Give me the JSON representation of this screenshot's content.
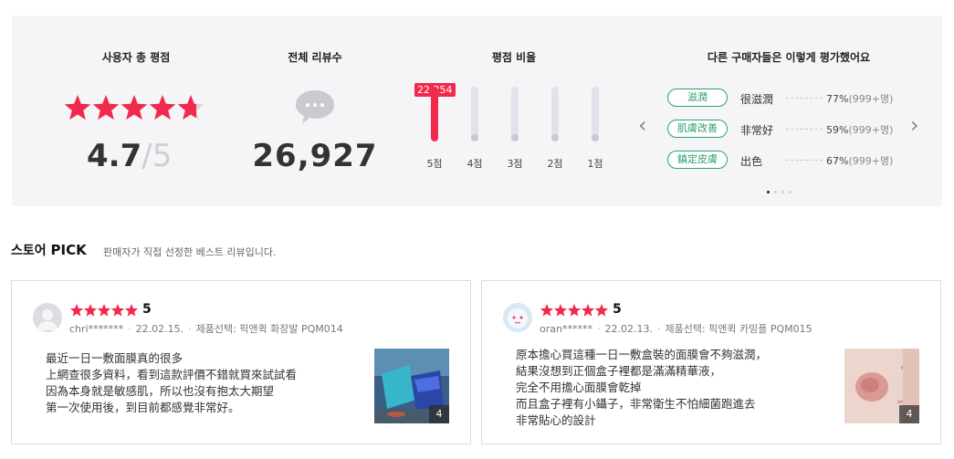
{
  "summary": {
    "rating_title": "사용자 총 평점",
    "rating_value": "4.7",
    "rating_sep": "/",
    "rating_max": "5",
    "rating_stars": 4.7,
    "reviews_title": "전체 리뷰수",
    "reviews_total": "26,927",
    "ratio_title": "평점 비율",
    "ratio_badge": "22,254",
    "ratio_bars": [
      {
        "label": "5점",
        "fraction": 1.0
      },
      {
        "label": "4점",
        "fraction": 0.0
      },
      {
        "label": "3점",
        "fraction": 0.0
      },
      {
        "label": "2점",
        "fraction": 0.0
      },
      {
        "label": "1점",
        "fraction": 0.0
      }
    ],
    "opinion_title": "다른 구매자들은 이렇게 평가했어요",
    "opinions": [
      {
        "tag": "滋潤",
        "word": "很滋潤",
        "pct": "77%",
        "count": "(999+명)"
      },
      {
        "tag": "肌膚改善",
        "word": "非常好",
        "pct": "59%",
        "count": "(999+명)"
      },
      {
        "tag": "鎮定皮膚",
        "word": "出色",
        "pct": "67%",
        "count": "(999+명)"
      }
    ],
    "prev_icon": "chevron-left-icon",
    "next_icon": "chevron-right-icon"
  },
  "pick": {
    "title_prefix": "스토어",
    "title_em": "PICK",
    "subtitle": "판매자가 직접 선정한 베스트 리뷰입니다."
  },
  "reviews": [
    {
      "score": "5",
      "user": "chri*******",
      "date": "22.02.15.",
      "option": "제품선택: 픽앤퀵 화장발 PQM014",
      "lines": [
        "最近一日一敷面膜真的很多",
        "上網查很多資料，看到這款評價不錯就買來試試看",
        "因為本身就是敏感肌，所以也沒有抱太大期望",
        "第一次使用後，到目前都感覺非常好。"
      ],
      "photo_count": "4"
    },
    {
      "score": "5",
      "user": "oran******",
      "date": "22.02.13.",
      "option": "제품선택: 픽앤퀵 카밍플 PQM015",
      "lines": [
        "原本擔心買這種一日一敷盒裝的面膜會不夠滋潤，",
        "結果沒想到正個盒子裡都是滿滿精華液，",
        "完全不用擔心面膜會乾掉",
        "而且盒子裡有小鑷子，非常衛生不怕細菌跑進去",
        "非常貼心的設計"
      ],
      "photo_count": "4"
    }
  ],
  "colors": {
    "accent": "#f1294c",
    "tag_green": "#2aa36a",
    "panel_bg": "#f5f5f7"
  }
}
